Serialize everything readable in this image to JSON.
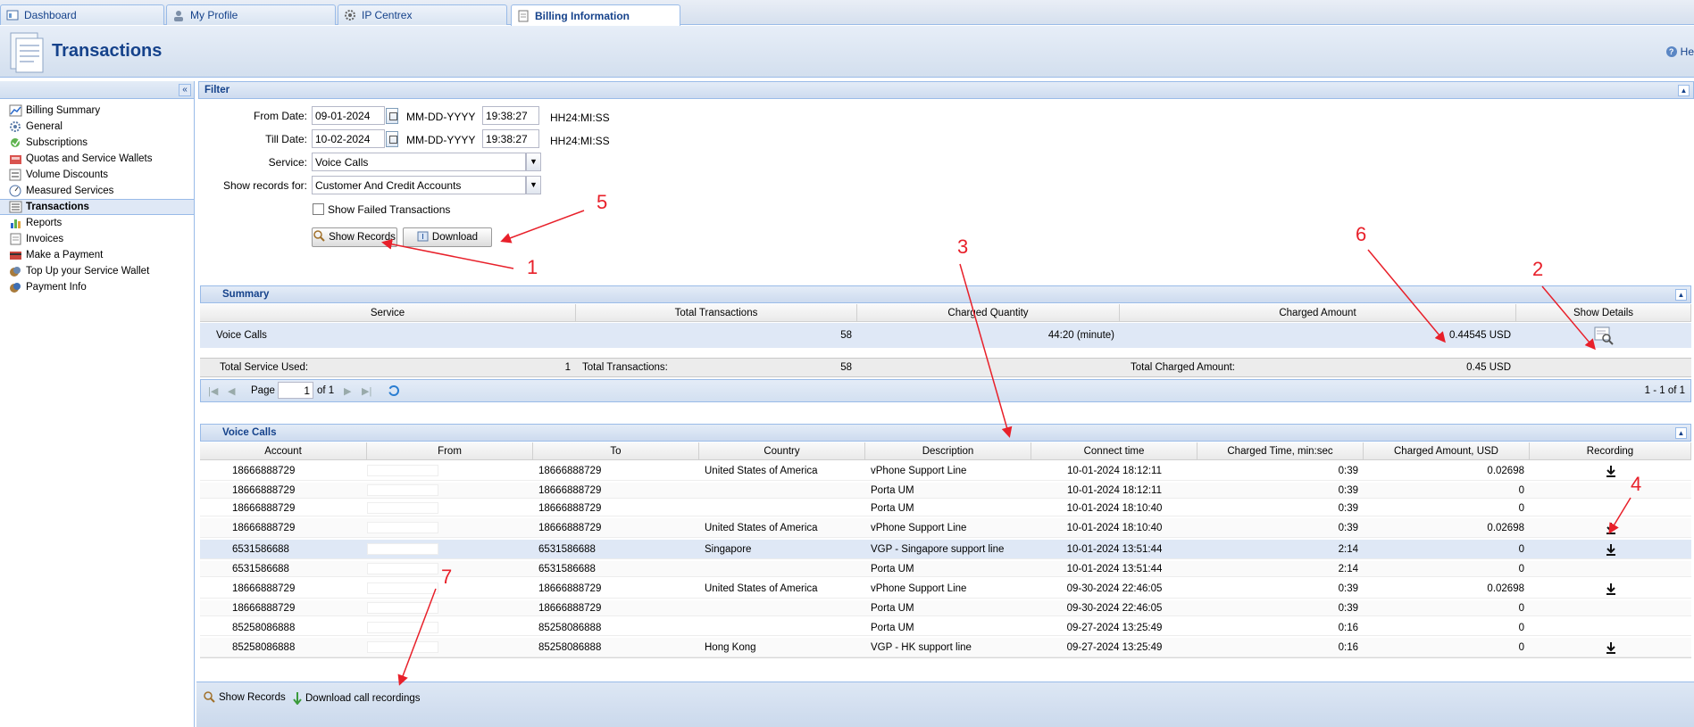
{
  "tabs": [
    {
      "label": "Dashboard"
    },
    {
      "label": "My Profile"
    },
    {
      "label": "IP Centrex"
    },
    {
      "label": "Billing Information"
    }
  ],
  "header": {
    "title": "Transactions",
    "help": "He"
  },
  "sidebar": {
    "collapse": "«",
    "items": [
      {
        "label": "Billing Summary"
      },
      {
        "label": "General"
      },
      {
        "label": "Subscriptions"
      },
      {
        "label": "Quotas and Service Wallets"
      },
      {
        "label": "Volume Discounts"
      },
      {
        "label": "Measured Services"
      },
      {
        "label": "Transactions"
      },
      {
        "label": "Reports"
      },
      {
        "label": "Invoices"
      },
      {
        "label": "Make a Payment"
      },
      {
        "label": "Top Up your Service Wallet"
      },
      {
        "label": "Payment Info"
      }
    ]
  },
  "filter": {
    "title": "Filter",
    "from_label": "From Date:",
    "from_date": "09-01-2024",
    "from_time": "19:38:27",
    "till_label": "Till Date:",
    "till_date": "10-02-2024",
    "till_time": "19:38:27",
    "date_fmt": "MM-DD-YYYY",
    "time_fmt": "HH24:MI:SS",
    "service_label": "Service:",
    "service_value": "Voice Calls",
    "records_label": "Show records for:",
    "records_value": "Customer And Credit Accounts",
    "failed_label": "Show Failed Transactions",
    "show_btn": "Show Records",
    "download_btn": "Download"
  },
  "summary": {
    "title": "Summary",
    "columns": [
      "Service",
      "Total Transactions",
      "Charged Quantity",
      "Charged Amount",
      "Show Details"
    ],
    "row": {
      "service": "Voice Calls",
      "transactions": "58",
      "quantity": "44:20 (minute)",
      "amount": "0.44545 USD"
    },
    "totals": {
      "service_used_label": "Total Service Used:",
      "service_used": "1",
      "transactions_label": "Total Transactions:",
      "transactions": "58",
      "charged_label": "Total Charged Amount:",
      "charged": "0.45 USD"
    },
    "pager": {
      "page_label": "Page",
      "page": "1",
      "of": "of 1",
      "range": "1 - 1 of 1"
    }
  },
  "calls": {
    "title": "Voice Calls",
    "columns": [
      "Account",
      "From",
      "To",
      "Country",
      "Description",
      "Connect time",
      "Charged Time, min:sec",
      "Charged Amount, USD",
      "Recording"
    ],
    "rows": [
      {
        "account": "18666888729",
        "to": "18666888729",
        "country": "United States of America",
        "desc": "vPhone Support Line",
        "time": "10-01-2024 18:12:11",
        "dur": "0:39",
        "amount": "0.02698",
        "rec": true
      },
      {
        "account": "18666888729",
        "to": "18666888729",
        "country": "",
        "desc": "Porta UM",
        "time": "10-01-2024 18:12:11",
        "dur": "0:39",
        "amount": "0",
        "rec": false
      },
      {
        "account": "18666888729",
        "to": "18666888729",
        "country": "",
        "desc": "Porta UM",
        "time": "10-01-2024 18:10:40",
        "dur": "0:39",
        "amount": "0",
        "rec": false
      },
      {
        "account": "18666888729",
        "to": "18666888729",
        "country": "United States of America",
        "desc": "vPhone Support Line",
        "time": "10-01-2024 18:10:40",
        "dur": "0:39",
        "amount": "0.02698",
        "rec": true
      },
      {
        "account": "6531586688",
        "to": "6531586688",
        "country": "Singapore",
        "desc": "VGP - Singapore support line",
        "time": "10-01-2024 13:51:44",
        "dur": "2:14",
        "amount": "0",
        "rec": true
      },
      {
        "account": "6531586688",
        "to": "6531586688",
        "country": "",
        "desc": "Porta UM",
        "time": "10-01-2024 13:51:44",
        "dur": "2:14",
        "amount": "0",
        "rec": false
      },
      {
        "account": "18666888729",
        "to": "18666888729",
        "country": "United States of America",
        "desc": "vPhone Support Line",
        "time": "09-30-2024 22:46:05",
        "dur": "0:39",
        "amount": "0.02698",
        "rec": true
      },
      {
        "account": "18666888729",
        "to": "18666888729",
        "country": "",
        "desc": "Porta UM",
        "time": "09-30-2024 22:46:05",
        "dur": "0:39",
        "amount": "0",
        "rec": false
      },
      {
        "account": "85258086888",
        "to": "85258086888",
        "country": "",
        "desc": "Porta UM",
        "time": "09-27-2024 13:25:49",
        "dur": "0:16",
        "amount": "0",
        "rec": false
      },
      {
        "account": "85258086888",
        "to": "85258086888",
        "country": "Hong Kong",
        "desc": "VGP - HK support line",
        "time": "09-27-2024 13:25:49",
        "dur": "0:16",
        "amount": "0",
        "rec": true
      }
    ],
    "footer_show": "Show Records",
    "footer_download": "Download call recordings"
  },
  "annotations": [
    "1",
    "2",
    "3",
    "4",
    "5",
    "6",
    "7"
  ],
  "accent": "#15428b",
  "annotation_color": "#e8202a"
}
